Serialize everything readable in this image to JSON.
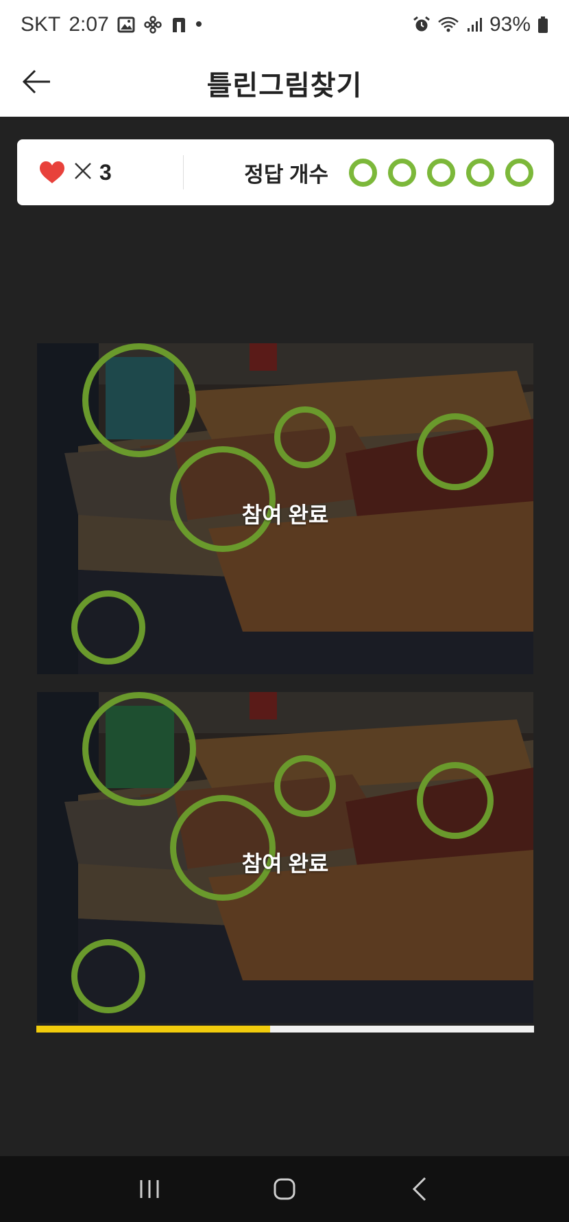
{
  "status_bar": {
    "carrier": "SKT",
    "time": "2:07",
    "dot": "•",
    "battery": "93%",
    "icons": [
      "gallery-icon",
      "flower-icon",
      "n-app-icon",
      "alarm-icon",
      "wifi-icon",
      "signal-icon",
      "battery-icon"
    ]
  },
  "header": {
    "title": "틀린그림찾기",
    "back_icon": "back-arrow-icon"
  },
  "score": {
    "lives_icon": "heart-icon",
    "lives_times": "×",
    "lives": "3",
    "answers_label": "정답 개수",
    "answers_total": 5,
    "answer_color": "#7cb83a"
  },
  "puzzle": {
    "top_overlay": "참여 완료",
    "bottom_overlay": "참여 완료",
    "found_spots": 5,
    "circle_color": "#6a9a2c"
  },
  "progress": {
    "fraction": 0.47,
    "color": "#f2cc0c"
  },
  "nav": {
    "recents_icon": "recents-icon",
    "home_icon": "home-icon",
    "back_icon": "nav-back-icon"
  },
  "colors": {
    "background": "#222222",
    "heart": "#e8413b"
  }
}
